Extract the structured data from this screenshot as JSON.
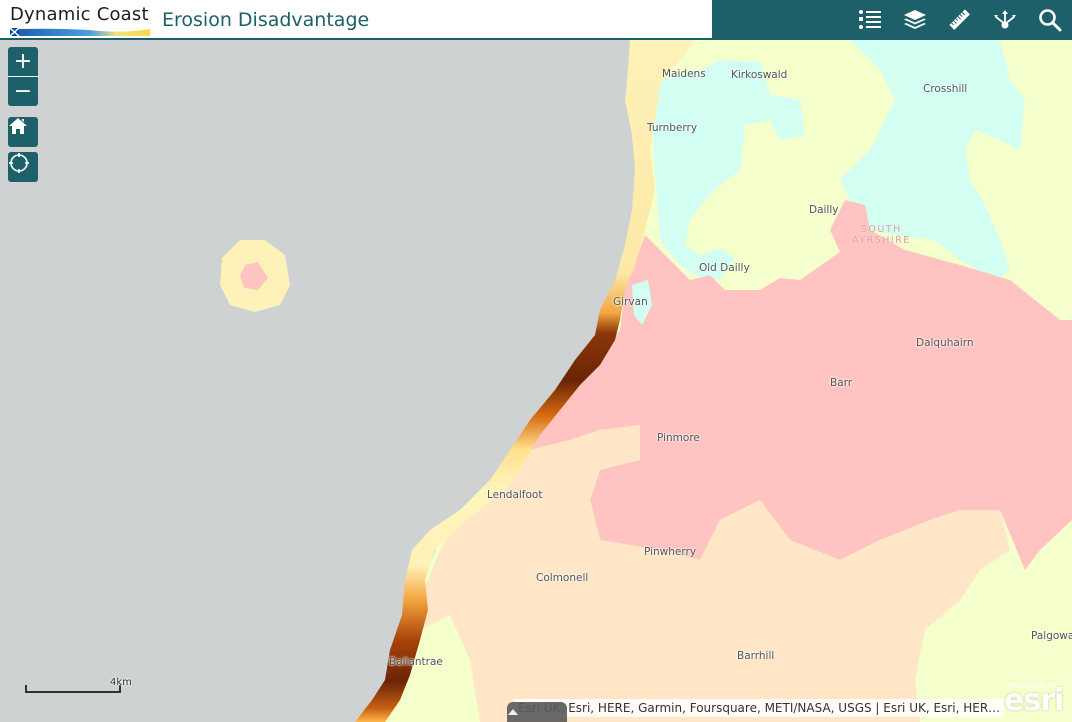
{
  "header": {
    "logo_text": "Dynamic Coast",
    "title": "Erosion Disadvantage",
    "tools": [
      {
        "name": "legend",
        "icon": "legend-list-icon"
      },
      {
        "name": "layers",
        "icon": "layers-icon"
      },
      {
        "name": "measure",
        "icon": "ruler-icon"
      },
      {
        "name": "share",
        "icon": "share-icon"
      },
      {
        "name": "search",
        "icon": "search-icon"
      }
    ]
  },
  "map_controls": {
    "zoom_in": "+",
    "zoom_out": "−",
    "home": "home-icon",
    "locate": "locate-icon"
  },
  "places": [
    {
      "name": "Maidens"
    },
    {
      "name": "Kirkoswald"
    },
    {
      "name": "Crosshill"
    },
    {
      "name": "Turnberry"
    },
    {
      "name": "Dailly"
    },
    {
      "name": "Old Dailly"
    },
    {
      "name": "Girvan"
    },
    {
      "name": "Dalquhairn"
    },
    {
      "name": "Barr"
    },
    {
      "name": "Pinmore"
    },
    {
      "name": "Lendalfoot"
    },
    {
      "name": "Pinwherry"
    },
    {
      "name": "Colmonell"
    },
    {
      "name": "Palgowa"
    },
    {
      "name": "Barrhill"
    },
    {
      "name": "Ballantrae"
    }
  ],
  "region_label": {
    "line1": "SOUTH",
    "line2": "AYRSHIRE"
  },
  "scale": {
    "label": "4km"
  },
  "attribution": "Esri UK, Esri, HERE, Garmin, Foursquare, METI/NASA, USGS | Esri UK, Esri, HER…",
  "esri": {
    "powered": "POWERED BY",
    "word": "esri"
  },
  "colors": {
    "accent": "#1d6069",
    "sea": "#cfd2d3",
    "zone_cyan": "#d2fff2",
    "zone_yellow": "#f4ffcc",
    "zone_pink": "#ffc4c2",
    "zone_peach": "#ffe6c6",
    "erosion_low": "#fff2b8",
    "erosion_mid": "#f08a1c",
    "erosion_high": "#6b2406"
  }
}
